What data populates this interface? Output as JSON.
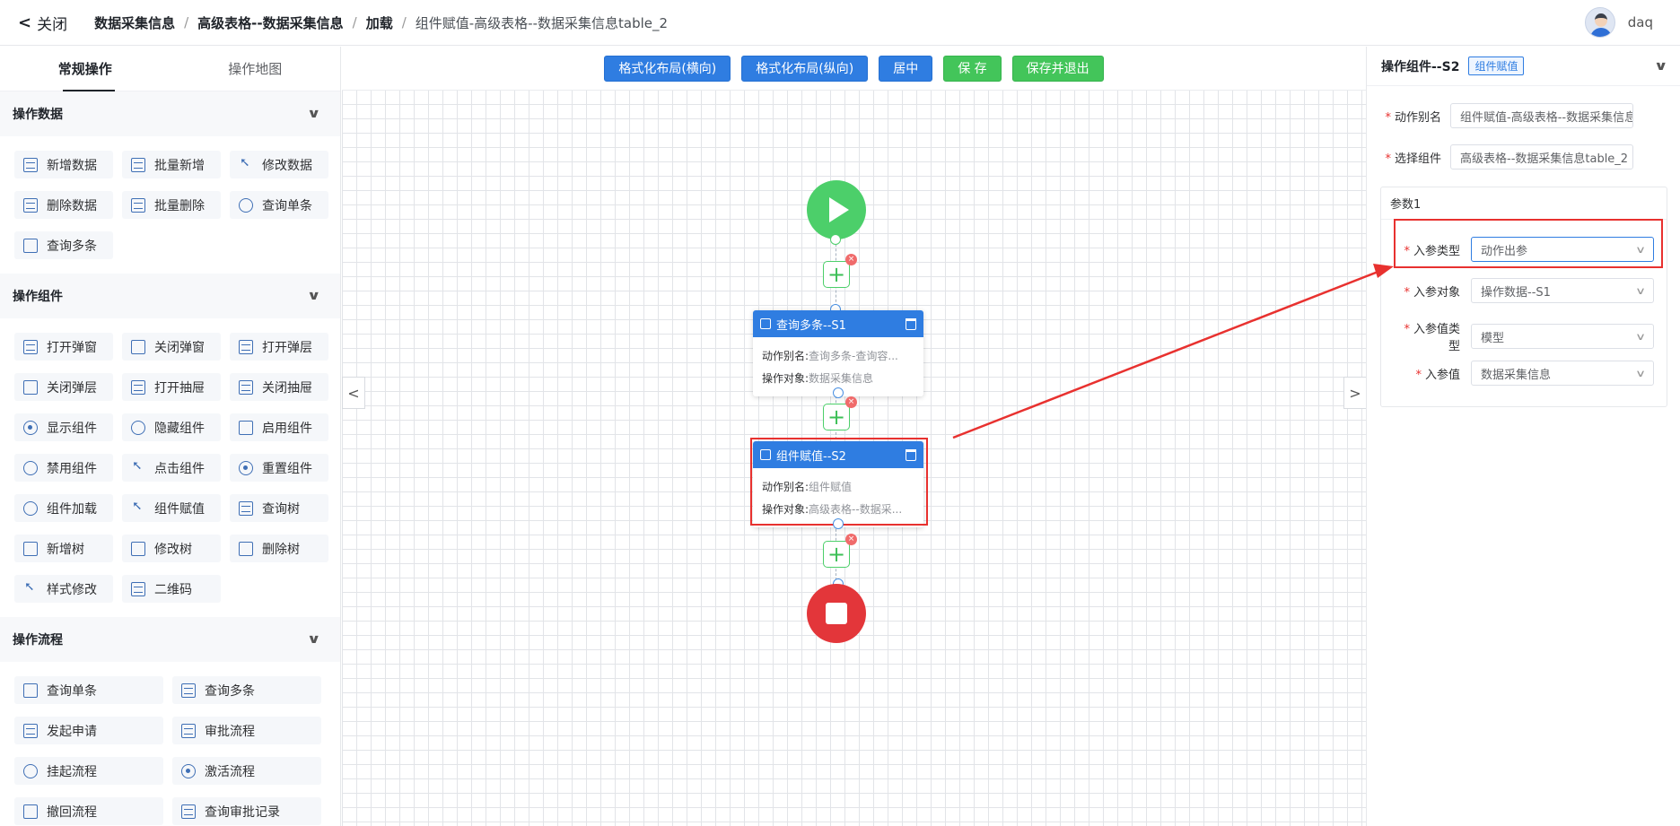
{
  "header": {
    "close_label": "关闭",
    "breadcrumbs": [
      "数据采集信息",
      "高级表格--数据采集信息",
      "加载",
      "组件赋值-高级表格--数据采集信息table_2"
    ],
    "username": "daq"
  },
  "left_panel": {
    "tabs": [
      "常规操作",
      "操作地图"
    ],
    "sections": [
      {
        "title": "操作数据",
        "items": [
          "新增数据",
          "批量新增",
          "修改数据",
          "删除数据",
          "批量删除",
          "查询单条",
          "查询多条"
        ]
      },
      {
        "title": "操作组件",
        "items": [
          "打开弹窗",
          "关闭弹窗",
          "打开弹层",
          "关闭弹层",
          "打开抽屉",
          "关闭抽屉",
          "显示组件",
          "隐藏组件",
          "启用组件",
          "禁用组件",
          "点击组件",
          "重置组件",
          "组件加载",
          "组件赋值",
          "查询树",
          "新增树",
          "修改树",
          "删除树",
          "样式修改",
          "二维码"
        ]
      },
      {
        "title": "操作流程",
        "items": [
          "查询单条",
          "查询多条",
          "发起申请",
          "审批流程",
          "挂起流程",
          "激活流程",
          "撤回流程",
          "查询审批记录"
        ]
      }
    ]
  },
  "toolbar": {
    "format_h": "格式化布局(横向)",
    "format_v": "格式化布局(纵向)",
    "center": "居中",
    "save": "保 存",
    "save_exit": "保存并退出"
  },
  "nodes": [
    {
      "title": "查询多条--S1",
      "alias_key": "动作别名:",
      "alias_val": "查询多条-查询容...",
      "target_key": "操作对象:",
      "target_val": "数据采集信息"
    },
    {
      "title": "组件赋值--S2",
      "alias_key": "动作别名:",
      "alias_val": "组件赋值",
      "target_key": "操作对象:",
      "target_val": "高级表格--数据采..."
    }
  ],
  "right_panel": {
    "title": "操作组件--S2",
    "badge": "组件赋值",
    "alias_label": "动作别名",
    "alias_value": "组件赋值-高级表格--数据采集信息tab",
    "component_label": "选择组件",
    "component_value": "高级表格--数据采集信息table_2",
    "param_title": "参数1",
    "param_type_label": "入参类型",
    "param_type_value": "动作出参",
    "param_obj_label": "入参对象",
    "param_obj_value": "操作数据--S1",
    "param_valtype_label": "入参值类型",
    "param_valtype_value": "模型",
    "param_value_label": "入参值",
    "param_value_value": "数据采集信息"
  },
  "colors": {
    "primary": "#2f7de1",
    "success": "#43c55a",
    "danger": "#e3363a",
    "highlight": "#e8312f"
  }
}
